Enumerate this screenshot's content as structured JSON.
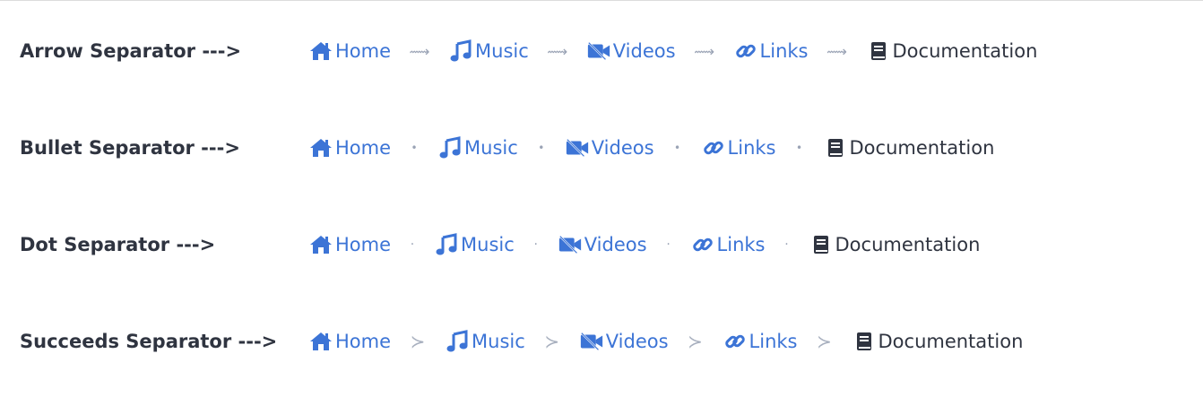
{
  "colors": {
    "link": "#3c74d6",
    "current": "#2f3440",
    "separator": "#9aa3b5"
  },
  "rows": [
    {
      "label": "Arrow Separator --->",
      "separator": "⟿",
      "items": [
        {
          "icon": "home-icon",
          "label": "Home"
        },
        {
          "icon": "music-icon",
          "label": "Music"
        },
        {
          "icon": "video-icon",
          "label": "Videos"
        },
        {
          "icon": "link-icon",
          "label": "Links"
        },
        {
          "icon": "book-icon",
          "label": "Documentation"
        }
      ]
    },
    {
      "label": "Bullet Separator --->",
      "separator": "•",
      "items": [
        {
          "icon": "home-icon",
          "label": "Home"
        },
        {
          "icon": "music-icon",
          "label": "Music"
        },
        {
          "icon": "video-icon",
          "label": "Videos"
        },
        {
          "icon": "link-icon",
          "label": "Links"
        },
        {
          "icon": "book-icon",
          "label": "Documentation"
        }
      ]
    },
    {
      "label": "Dot Separator --->",
      "separator": "·",
      "items": [
        {
          "icon": "home-icon",
          "label": "Home"
        },
        {
          "icon": "music-icon",
          "label": "Music"
        },
        {
          "icon": "video-icon",
          "label": "Videos"
        },
        {
          "icon": "link-icon",
          "label": "Links"
        },
        {
          "icon": "book-icon",
          "label": "Documentation"
        }
      ]
    },
    {
      "label": "Succeeds Separator --->",
      "separator": "≻",
      "items": [
        {
          "icon": "home-icon",
          "label": "Home"
        },
        {
          "icon": "music-icon",
          "label": "Music"
        },
        {
          "icon": "video-icon",
          "label": "Videos"
        },
        {
          "icon": "link-icon",
          "label": "Links"
        },
        {
          "icon": "book-icon",
          "label": "Documentation"
        }
      ]
    }
  ]
}
